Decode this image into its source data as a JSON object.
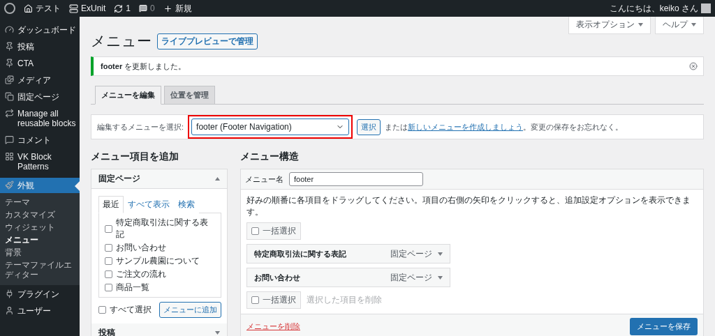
{
  "admin_bar": {
    "site": "テスト",
    "plugin": "ExUnit",
    "updates": "1",
    "comments": "0",
    "new": "新規",
    "greeting": "こんにちは、keiko さん"
  },
  "sidebar": {
    "items": [
      {
        "label": "ダッシュボード",
        "selected": false
      },
      {
        "label": "投稿",
        "selected": false
      },
      {
        "label": "CTA",
        "selected": false
      },
      {
        "label": "メディア",
        "selected": false
      },
      {
        "label": "固定ページ",
        "selected": false
      },
      {
        "label": "Manage all reusable blocks",
        "selected": false
      },
      {
        "label": "コメント",
        "selected": false
      },
      {
        "label": "VK Block Patterns",
        "selected": false
      },
      {
        "label": "外観",
        "selected": true,
        "children": [
          {
            "label": "テーマ",
            "selected": false
          },
          {
            "label": "カスタマイズ",
            "selected": false
          },
          {
            "label": "ウィジェット",
            "selected": false
          },
          {
            "label": "メニュー",
            "selected": true
          },
          {
            "label": "背景",
            "selected": false
          },
          {
            "label": "テーマファイルエディター",
            "selected": false
          }
        ]
      },
      {
        "label": "プラグイン",
        "selected": false
      },
      {
        "label": "ユーザー",
        "selected": false
      }
    ]
  },
  "screen_buttons": [
    "表示オプション",
    "ヘルプ"
  ],
  "page_title": "メニュー",
  "live_preview_button": "ライブプレビューで管理",
  "notice": {
    "text": "**footer** を更新しました。"
  },
  "tabs": [
    {
      "label": "メニューを編集",
      "selected": true
    },
    {
      "label": "位置を管理",
      "selected": false
    }
  ],
  "menu_select": {
    "label": "編集するメニューを選択:",
    "value": "footer (Footer Navigation)",
    "highlighted": true,
    "button": "選択",
    "note_before": "または",
    "link": "新しいメニューを作成しましょう",
    "note_after": "。変更の保存をお忘れなく。"
  },
  "add_items": {
    "title": "メニュー項目を追加",
    "panels": [
      {
        "title": "固定ページ",
        "expanded": true,
        "tabs": [
          {
            "label": "最近",
            "selected": true
          },
          {
            "label": "すべて表示",
            "selected": false
          },
          {
            "label": "検索",
            "selected": false
          }
        ],
        "items": [
          {
            "label": "特定商取引法に関する表記",
            "checked": false
          },
          {
            "label": "お問い合わせ",
            "checked": false
          },
          {
            "label": "サンプル農園について",
            "checked": false
          },
          {
            "label": "ご注文の流れ",
            "checked": false
          },
          {
            "label": "商品一覧",
            "checked": false
          }
        ],
        "select_all": {
          "label": "すべて選択",
          "checked": false
        },
        "add_button": "メニューに追加"
      },
      {
        "title": "投稿",
        "expanded": false
      }
    ]
  },
  "structure": {
    "title": "メニュー構造",
    "name_label": "メニュー名",
    "name_value": "footer",
    "instructions": "好みの順番に各項目をドラッグしてください。項目の右側の矢印をクリックすると、追加設定オプションを表示できます。",
    "bulk_select": {
      "label": "一括選択",
      "checked": false
    },
    "items": [
      {
        "label": "特定商取引法に関する表記",
        "type": "固定ページ"
      },
      {
        "label": "お問い合わせ",
        "type": "固定ページ"
      }
    ],
    "bulk_bottom": {
      "label": "一括選択",
      "checked": false,
      "delete_label": "選択した項目を削除"
    },
    "delete_link": "メニューを削除",
    "save_button": "メニューを保存"
  }
}
